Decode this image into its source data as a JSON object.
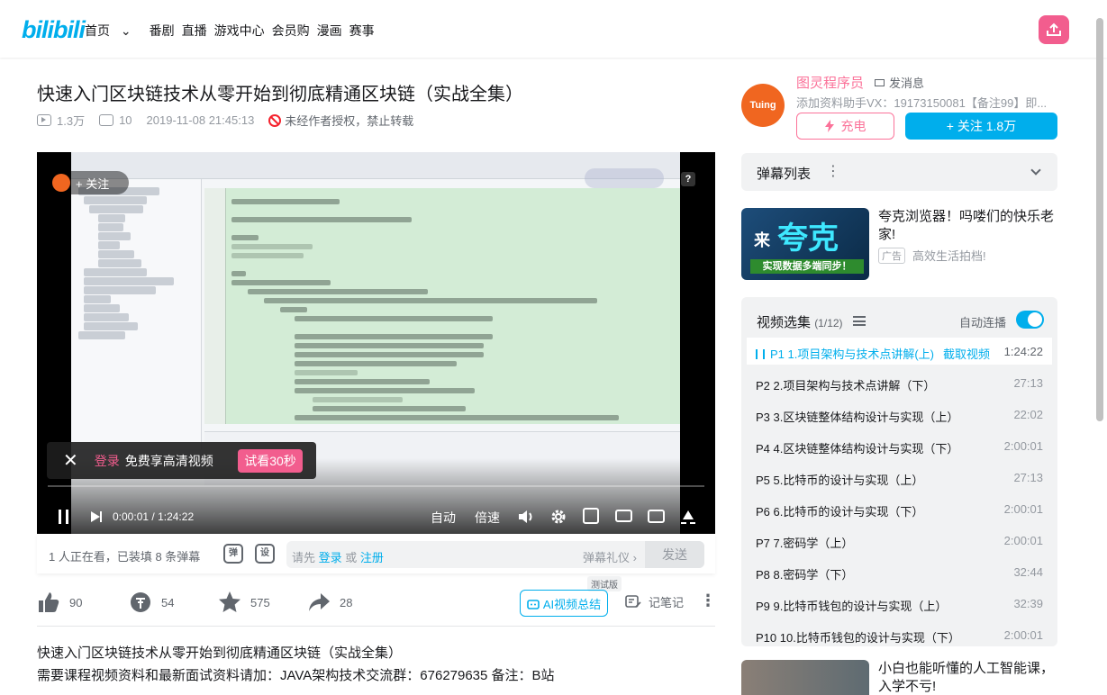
{
  "header": {
    "logo": "bilibili",
    "nav": [
      "首页",
      "番剧",
      "直播",
      "游戏中心",
      "会员购",
      "漫画",
      "赛事"
    ]
  },
  "video": {
    "title": "快速入门区块链技术从零开始到彻底精通区块链（实战全集）",
    "views": "1.3万",
    "danmaku": "10",
    "date": "2019-11-08 21:45:13",
    "copyright": "未经作者授权，禁止转载"
  },
  "player": {
    "follow": "+ 关注",
    "login_tip": {
      "login": "登录",
      "text": "免费享高清视频",
      "trial": "试看30秒"
    },
    "time_current": "0:00:01",
    "time_sep": "/",
    "time_total": "1:24:22",
    "auto": "自动",
    "speed": "倍速",
    "help": "?"
  },
  "danmaku_bar": {
    "info": "1 人正在看，已装填 8 条弹幕",
    "toggle1": "弹",
    "toggle2": "设",
    "prompt": "请先",
    "login": "登录",
    "or": "或",
    "register": "注册",
    "etiquette": "弹幕礼仪 ›",
    "send": "发送"
  },
  "actions": {
    "like": "90",
    "coin": "54",
    "fav": "575",
    "share": "28",
    "ai_badge": "测试版",
    "ai": "AI视频总结",
    "note": "记笔记"
  },
  "description": [
    "快速入门区块链技术从零开始到彻底精通区块链（实战全集）",
    "需要课程视频资料和最新面试资料请加：JAVA架构技术交流群：676279635 备注：B站"
  ],
  "uploader": {
    "avatar_text": "Tuing",
    "name": "图灵程序员",
    "message": "发消息",
    "desc": "添加资料助手VX：19173150081【备注99】即...",
    "charge": "充电",
    "follow": "+ 关注 1.8万"
  },
  "danmaku_list": {
    "label": "弹幕列表",
    "dots": "⋮"
  },
  "ad": {
    "img_big": "夸克",
    "img_small": "来",
    "img_bar": "实现数据多端同步！",
    "title": "夸克浏览器！吗喽们的快乐老家!",
    "tag": "广告",
    "sub": "高效生活拍档!"
  },
  "playlist": {
    "title": "视频选集",
    "count": "(1/12)",
    "autoplay": "自动连播",
    "snap": "截取视频",
    "items": [
      {
        "title": "P1  1.项目架构与技术点讲解(上)",
        "duration": "1:24:22"
      },
      {
        "title": "P2  2.项目架构与技术点讲解（下）",
        "duration": "27:13"
      },
      {
        "title": "P3  3.区块链整体结构设计与实现（上）",
        "duration": "22:02"
      },
      {
        "title": "P4  4.区块链整体结构设计与实现（下）",
        "duration": "2:00:01"
      },
      {
        "title": "P5  5.比特币的设计与实现（上）",
        "duration": "27:13"
      },
      {
        "title": "P6  6.比特币的设计与实现（下）",
        "duration": "2:00:01"
      },
      {
        "title": "P7  7.密码学（上）",
        "duration": "2:00:01"
      },
      {
        "title": "P8  8.密码学（下）",
        "duration": "32:44"
      },
      {
        "title": "P9  9.比特币钱包的设计与实现（上）",
        "duration": "32:39"
      },
      {
        "title": "P10  10.比特币钱包的设计与实现（下）",
        "duration": "2:00:01"
      }
    ]
  },
  "recommend": {
    "title": "小白也能听懂的人工智能课，入学不亏!"
  }
}
